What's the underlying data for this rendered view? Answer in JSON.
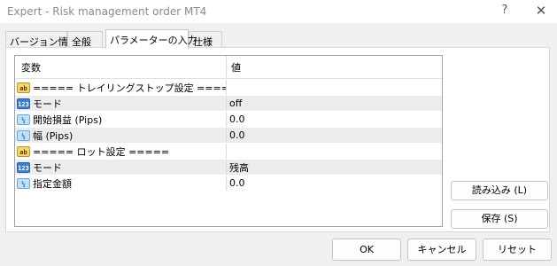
{
  "window": {
    "title": "Expert - Risk management order MT4",
    "help_glyph": "?",
    "close_glyph": "✕"
  },
  "tabs": [
    {
      "label": "バージョン情報"
    },
    {
      "label": "全般"
    },
    {
      "label": "パラメーターの入力"
    },
    {
      "label": "仕様"
    }
  ],
  "grid": {
    "col_name": "変数",
    "col_value": "値",
    "rows": [
      {
        "type": "ab",
        "name": "===== トレイリングストップ設定 =====",
        "value": ""
      },
      {
        "type": "123",
        "name": "モード",
        "value": "off"
      },
      {
        "type": "v2",
        "name": "開始損益 (Pips)",
        "value": "0.0"
      },
      {
        "type": "v2",
        "name": "幅 (Pips)",
        "value": "0.0"
      },
      {
        "type": "ab",
        "name": "===== ロット設定 =====",
        "value": ""
      },
      {
        "type": "123",
        "name": "モード",
        "value": "残高"
      },
      {
        "type": "v2",
        "name": "指定金額",
        "value": "0.0"
      }
    ]
  },
  "icons": {
    "ab": "ab",
    "123": "123",
    "v2": "½"
  },
  "buttons": {
    "load": "読み込み (L)",
    "save": "保存 (S)",
    "ok": "OK",
    "cancel": "キャンセル",
    "reset": "リセット"
  },
  "colors": {
    "active_tab": "#ffffff",
    "row_shade": "#ececec"
  }
}
